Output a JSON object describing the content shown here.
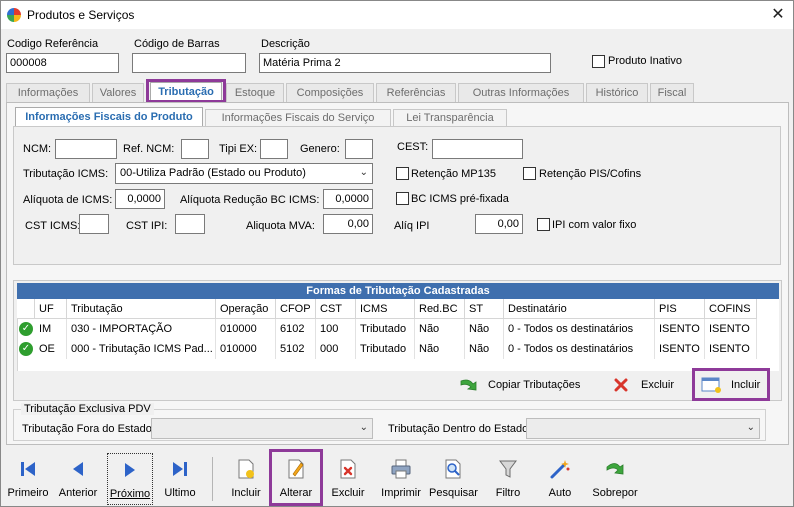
{
  "window": {
    "title": "Produtos e Serviços",
    "close": "✕"
  },
  "header": {
    "codigo_label": "Codigo Referência",
    "codigo_value": "000008",
    "barras_label": "Código de Barras",
    "barras_value": "",
    "descricao_label": "Descrição",
    "descricao_value": "Matéria Prima 2",
    "inativo_label": "Produto Inativo"
  },
  "tabs": [
    "Informações",
    "Valores",
    "Tributação",
    "Estoque",
    "Composições",
    "Referências",
    "Outras Informações",
    "Histórico",
    "Fiscal"
  ],
  "subtabs": [
    "Informações Fiscais do Produto",
    "Informações Fiscais do Serviço",
    "Lei Transparência"
  ],
  "fiscal": {
    "ncm_label": "NCM:",
    "refncm_label": "Ref. NCM:",
    "tipiex_label": "Tipi EX:",
    "genero_label": "Genero:",
    "cest_label": "CEST:",
    "trib_icms_label": "Tributação ICMS:",
    "trib_icms_value": "00-Utiliza Padrão (Estado ou Produto)",
    "retencao_mp_label": "Retenção MP135",
    "retencao_pis_label": "Retenção PIS/Cofins",
    "aliq_icms_label": "Alíquota de ICMS:",
    "aliq_icms_value": "0,0000",
    "aliq_red_label": "Alíquota Redução BC ICMS:",
    "aliq_red_value": "0,0000",
    "bc_prefix_label": "BC ICMS pré-fixada",
    "cst_icms_label": "CST ICMS:",
    "cst_ipi_label": "CST IPI:",
    "aliq_mva_label": "Aliquota MVA:",
    "aliq_mva_value": "0,00",
    "aliq_ipi_label": "Alíq IPI",
    "aliq_ipi_value": "0,00",
    "ipi_fixo_label": "IPI com valor fixo"
  },
  "grid": {
    "title": "Formas de Tributação Cadastradas",
    "columns": [
      "UF",
      "Tributação",
      "Operação",
      "CFOP",
      "CST",
      "ICMS",
      "Red.BC",
      "ST",
      "Destinatário",
      "PIS",
      "COFINS"
    ],
    "rows": [
      [
        "IM",
        "030 - IMPORTAÇÃO",
        "010000",
        "6102",
        "100",
        "Tributado",
        "Não",
        "Não",
        "0 - Todos os destinatários",
        "ISENTO",
        "ISENTO"
      ],
      [
        "OE",
        "000 - Tributação ICMS Pad...",
        "010000",
        "5102",
        "000",
        "Tributado",
        "Não",
        "Não",
        "0 - Todos os destinatários",
        "ISENTO",
        "ISENTO"
      ]
    ],
    "copiar_label": "Copiar Tributações",
    "excluir_label": "Excluir",
    "incluir_label": "Incluir"
  },
  "pdv": {
    "group_title": "Tributação Exclusiva PDV",
    "fora_label": "Tributação Fora do Estado",
    "dentro_label": "Tributação Dentro do Estado"
  },
  "toolbar": [
    "Primeiro",
    "Anterior",
    "Próximo",
    "Ultimo",
    "Incluir",
    "Alterar",
    "Excluir",
    "Imprimir",
    "Pesquisar",
    "Filtro",
    "Auto",
    "Sobrepor"
  ],
  "colors": {
    "accent": "#2a6db1",
    "highlight": "#8e3a99",
    "grid_header": "#3f6fae"
  }
}
